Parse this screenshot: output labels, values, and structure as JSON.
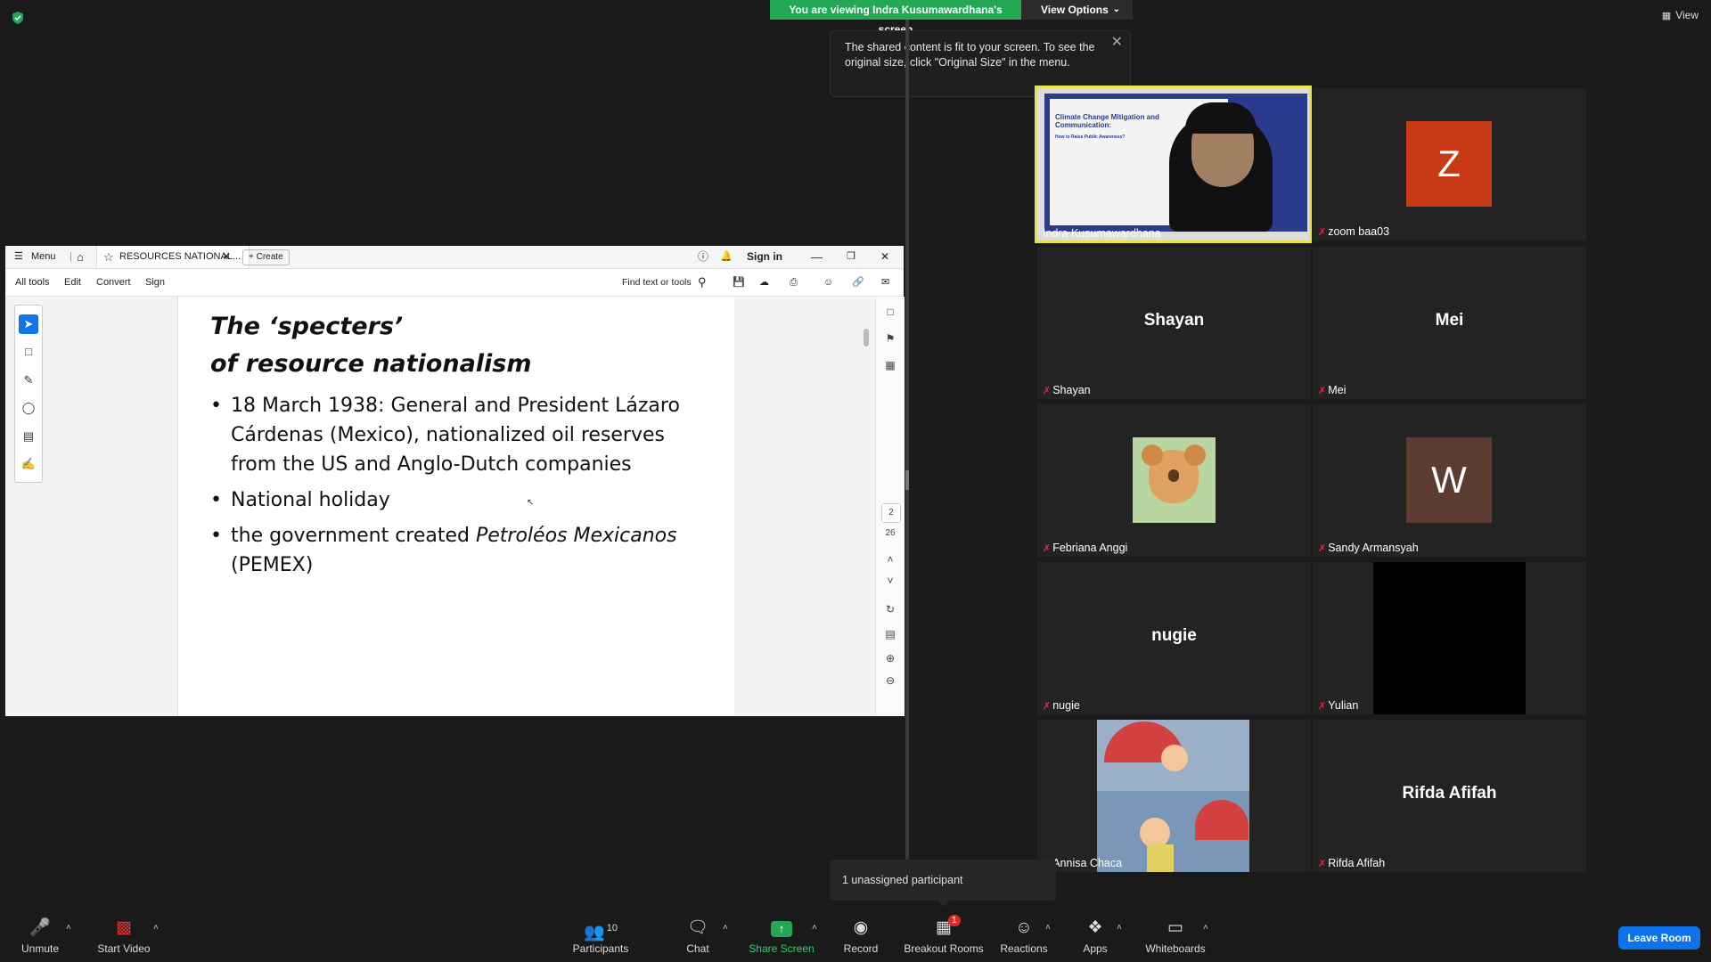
{
  "banner": {
    "viewing_text": "You are viewing Indra Kusumawardhana's screen",
    "view_options": "View Options"
  },
  "top_right_view": "View",
  "tooltip": {
    "text": "The shared content is fit to your screen. To see the original size, click \"Original Size\" in the menu."
  },
  "acrobat": {
    "menu": "Menu",
    "tab_title": "RESOURCES NATIONAL...",
    "create": "Create",
    "sign_in": "Sign in",
    "toolbar": {
      "all_tools": "All tools",
      "edit": "Edit",
      "convert": "Convert",
      "sign": "Sign",
      "find": "Find text or tools"
    },
    "page_current": "2",
    "page_total": "26"
  },
  "slide": {
    "title_line1": "The ‘specters’",
    "title_line2": "of resource nationalism",
    "bullets": [
      "18 March 1938: General and President Lázaro Cárdenas (Mexico), nationalized oil reserves from the US and Anglo-Dutch companies",
      "National holiday"
    ],
    "bullet3_pre": "the government created ",
    "bullet3_italic": "Petroléos Mexicanos",
    "bullet3_post": " (PEMEX)"
  },
  "participants_tiles": [
    {
      "name": "Indra Kusumawardhana"
    },
    {
      "name": "zoom baa03",
      "initial": "Z"
    },
    {
      "name": "Shayan",
      "label": "Shayan"
    },
    {
      "name": "Mei",
      "label": "Mei"
    },
    {
      "name": "Febriana Anggi"
    },
    {
      "name": "Sandy Armansyah",
      "initial": "W"
    },
    {
      "name": "nugie",
      "label": "nugie"
    },
    {
      "name": "Yulian"
    },
    {
      "name": "Annisa Chaca"
    },
    {
      "name": "Rifda Afifah",
      "label": "Rifda Afifah"
    }
  ],
  "thumb_slide_title": "Climate Change Mitigation and Communication:",
  "thumb_slide_sub": "How to Raise Public Awareness?",
  "unassigned": "1 unassigned participant",
  "bottom": {
    "unmute": "Unmute",
    "start_video": "Start Video",
    "participants": "Participants",
    "participants_count": "10",
    "chat": "Chat",
    "share_screen": "Share Screen",
    "record": "Record",
    "breakout_rooms": "Breakout Rooms",
    "breakout_badge": "1",
    "reactions": "Reactions",
    "apps": "Apps",
    "whiteboards": "Whiteboards",
    "leave_room": "Leave Room"
  },
  "colors": {
    "green": "#23a955",
    "leave_blue": "#0e72ed",
    "z_avatar": "#c83a14",
    "w_avatar": "#5c3b31",
    "speaker_border": "#e9e34a"
  }
}
